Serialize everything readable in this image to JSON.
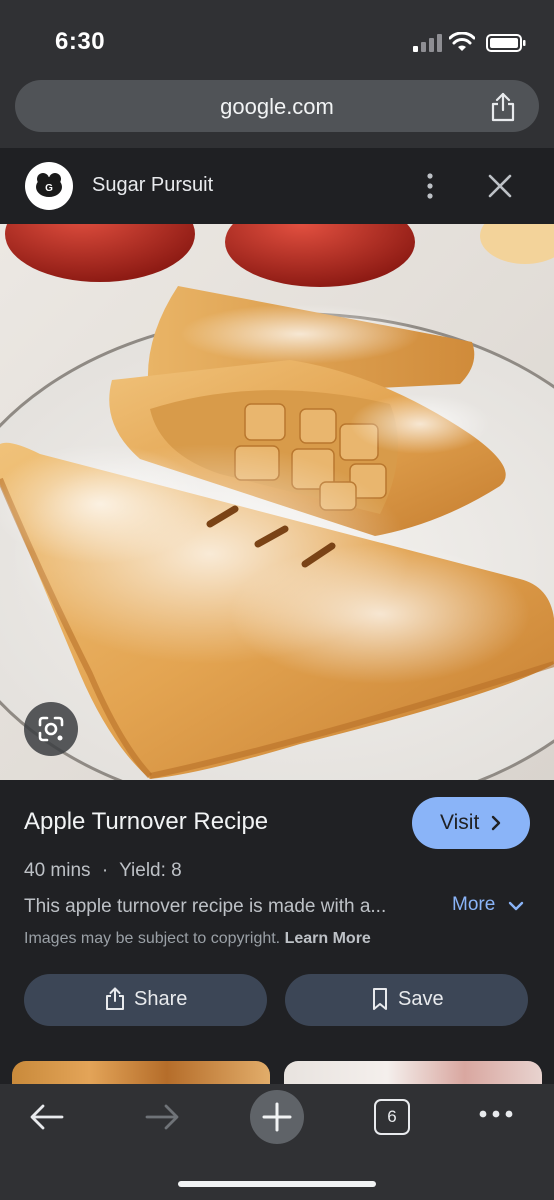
{
  "status_bar": {
    "time": "6:30"
  },
  "browser": {
    "url": "google.com"
  },
  "source": {
    "name": "Sugar Pursuit",
    "logo_letter": "G"
  },
  "result": {
    "title": "Apple Turnover Recipe",
    "visit_label": "Visit",
    "time": "40 mins",
    "separator": "·",
    "yield": "Yield: 8",
    "description": "This apple turnover recipe is made with a...",
    "more_label": "More",
    "copyright_text": "Images may be subject to copyright.",
    "learn_more": "Learn More",
    "share_label": "Share",
    "save_label": "Save"
  },
  "bottom_nav": {
    "tab_count": "6"
  },
  "colors": {
    "accent": "#8ab4f8",
    "background": "#202124",
    "button": "#3c4656"
  },
  "icons": [
    "signal-icon",
    "wifi-icon",
    "battery-icon",
    "share-icon",
    "more-vert-icon",
    "close-icon",
    "lens-icon",
    "chevron-right-icon",
    "chevron-down-icon",
    "bookmark-icon",
    "back-arrow-icon",
    "forward-arrow-icon",
    "plus-icon",
    "tabs-icon",
    "more-horiz-icon"
  ]
}
